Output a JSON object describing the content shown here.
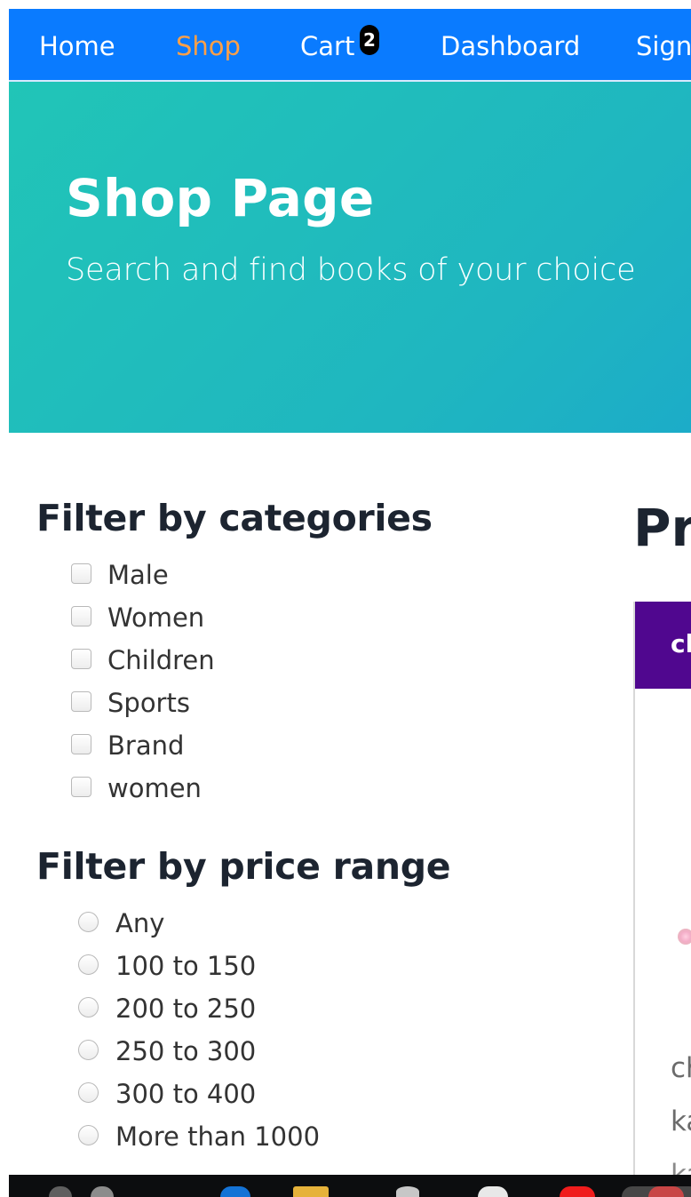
{
  "nav": {
    "items": [
      {
        "label": "Home",
        "active": false
      },
      {
        "label": "Shop",
        "active": true
      },
      {
        "label": "Cart",
        "active": false
      },
      {
        "label": "Dashboard",
        "active": false
      },
      {
        "label": "Sign",
        "active": false
      }
    ],
    "cart_count": "2",
    "brand_color": "#0a7bff",
    "active_color": "#ffa047"
  },
  "hero": {
    "title": "Shop Page",
    "subtitle": "Search and find books of your choice",
    "background_color": "#21c5b7"
  },
  "filters": {
    "categories_heading": "Filter by categories",
    "categories": [
      {
        "label": "Male",
        "checked": false
      },
      {
        "label": "Women",
        "checked": false
      },
      {
        "label": "Children",
        "checked": false
      },
      {
        "label": "Sports",
        "checked": false
      },
      {
        "label": "Brand",
        "checked": false
      },
      {
        "label": "women",
        "checked": false
      }
    ],
    "price_heading": "Filter by price range",
    "price_ranges": [
      {
        "label": "Any",
        "selected": false
      },
      {
        "label": "100 to 150",
        "selected": false
      },
      {
        "label": "200 to 250",
        "selected": false
      },
      {
        "label": "250 to 300",
        "selected": false
      },
      {
        "label": "300 to 400",
        "selected": false
      },
      {
        "label": "More than 1000",
        "selected": false
      }
    ]
  },
  "products": {
    "title_fragment": "Pr",
    "card": {
      "header_fragment": "ch",
      "line_fragments": [
        "ch",
        "ka",
        "ka"
      ],
      "header_color": "#50078f"
    }
  },
  "taskbar": {
    "icons": [
      "app-icon",
      "app-icon",
      "edge-icon",
      "folder-icon",
      "app-icon",
      "app-icon",
      "chrome-icon",
      "active-app-icon",
      "app-icon"
    ]
  }
}
